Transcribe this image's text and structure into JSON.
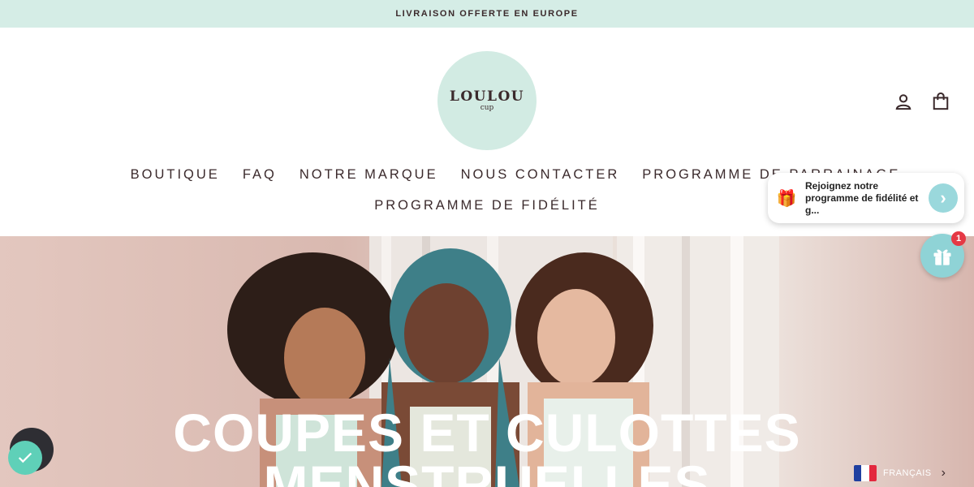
{
  "announcement": {
    "text": "LIVRAISON OFFERTE EN EUROPE"
  },
  "logo": {
    "main": "LOULOU",
    "sub": "cup"
  },
  "header": {
    "account_icon": "account-icon",
    "cart_icon": "cart-icon"
  },
  "nav": {
    "row1": [
      "BOUTIQUE",
      "FAQ",
      "NOTRE MARQUE",
      "NOUS CONTACTER",
      "PROGRAMME DE PARRAINAGE"
    ],
    "row2": [
      "PROGRAMME DE FIDÉLITÉ"
    ]
  },
  "hero": {
    "title_line1": "COUPES ET CULOTTES",
    "title_line2": "MENSTRUELLES"
  },
  "loyalty": {
    "message": "Rejoignez notre programme de fidélité et g...",
    "badge_count": "1"
  },
  "language": {
    "label": "FRANÇAIS"
  },
  "colors": {
    "mint": "#d5ede6",
    "text": "#3b2a2c",
    "teal": "#8fd3d6",
    "badge": "#e53945"
  }
}
